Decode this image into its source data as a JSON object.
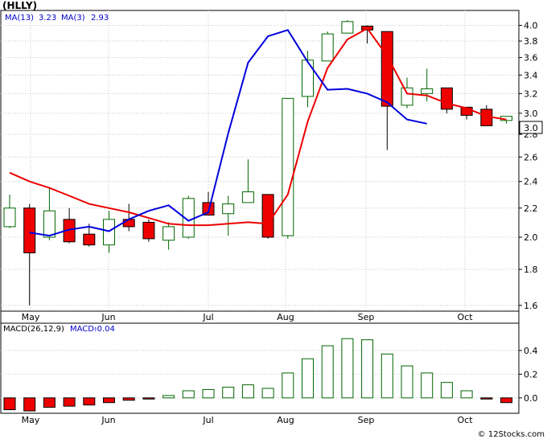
{
  "chart_data": [
    {
      "type": "candlestick",
      "title": "(HLLY)",
      "legend": [
        {
          "label": "MA(13)",
          "value": "3.23",
          "color": "#0000cc"
        },
        {
          "label": "MA(3)",
          "value": "2.93",
          "color": "#0000cc"
        }
      ],
      "price_axis": {
        "ticks": [
          "1.6",
          "1.8",
          "2.0",
          "2.2",
          "2.4",
          "2.6",
          "2.8",
          "3.0",
          "3.2",
          "3.4",
          "3.6",
          "3.8",
          "4.0"
        ],
        "log_scale": true,
        "range": [
          1.57,
          4.2
        ]
      },
      "last_price_label": "3.0",
      "months": [
        "May",
        "Jun",
        "Jul",
        "Aug",
        "Sep",
        "Oct"
      ],
      "candles": [
        {
          "o": 2.07,
          "h": 2.3,
          "l": 2.06,
          "c": 2.2
        },
        {
          "o": 2.2,
          "h": 2.23,
          "l": 1.6,
          "c": 1.9
        },
        {
          "o": 2.0,
          "h": 2.35,
          "l": 1.98,
          "c": 2.18
        },
        {
          "o": 2.12,
          "h": 2.2,
          "l": 1.96,
          "c": 1.97
        },
        {
          "o": 2.02,
          "h": 2.09,
          "l": 1.94,
          "c": 1.95
        },
        {
          "o": 1.95,
          "h": 2.18,
          "l": 1.9,
          "c": 2.12
        },
        {
          "o": 2.12,
          "h": 2.23,
          "l": 2.04,
          "c": 2.07
        },
        {
          "o": 2.1,
          "h": 2.12,
          "l": 1.97,
          "c": 1.99
        },
        {
          "o": 1.98,
          "h": 2.1,
          "l": 1.92,
          "c": 2.07
        },
        {
          "o": 2.0,
          "h": 2.29,
          "l": 1.99,
          "c": 2.27
        },
        {
          "o": 2.24,
          "h": 2.32,
          "l": 2.16,
          "c": 2.15
        },
        {
          "o": 2.16,
          "h": 2.29,
          "l": 2.01,
          "c": 2.23
        },
        {
          "o": 2.24,
          "h": 2.58,
          "l": 2.24,
          "c": 2.32
        },
        {
          "o": 2.3,
          "h": 2.3,
          "l": 1.99,
          "c": 2.0
        },
        {
          "o": 2.01,
          "h": 3.15,
          "l": 1.99,
          "c": 3.15
        },
        {
          "o": 3.17,
          "h": 3.68,
          "l": 3.06,
          "c": 3.57
        },
        {
          "o": 3.56,
          "h": 3.92,
          "l": 3.56,
          "c": 3.89
        },
        {
          "o": 3.9,
          "h": 4.07,
          "l": 3.9,
          "c": 4.05
        },
        {
          "o": 3.99,
          "h": 4.0,
          "l": 3.77,
          "c": 3.94
        },
        {
          "o": 3.92,
          "h": 3.92,
          "l": 2.66,
          "c": 3.07
        },
        {
          "o": 3.08,
          "h": 3.37,
          "l": 3.05,
          "c": 3.26
        },
        {
          "o": 3.2,
          "h": 3.47,
          "l": 3.12,
          "c": 3.25
        },
        {
          "o": 3.26,
          "h": 3.26,
          "l": 3.0,
          "c": 3.04
        },
        {
          "o": 3.06,
          "h": 3.06,
          "l": 2.94,
          "c": 2.98
        },
        {
          "o": 3.04,
          "h": 3.08,
          "l": 2.88,
          "c": 2.88
        },
        {
          "o": 2.93,
          "h": 2.97,
          "l": 2.9,
          "c": 2.97
        }
      ],
      "ma_red": [
        2.47,
        2.4,
        2.35,
        2.29,
        2.23,
        2.2,
        2.17,
        2.13,
        2.09,
        2.08,
        2.08,
        2.09,
        2.1,
        2.09,
        2.3,
        2.92,
        3.48,
        3.82,
        3.96,
        3.62,
        3.2,
        3.18,
        3.1,
        3.05,
        2.97,
        2.94
      ],
      "ma_red_start": 0,
      "ma_blue": [
        2.03,
        2.01,
        2.05,
        2.07,
        2.04,
        2.12,
        2.18,
        2.22,
        2.11,
        2.17,
        2.81,
        3.54,
        3.86,
        3.94,
        3.55,
        3.24,
        3.25,
        3.2,
        3.11,
        2.94,
        2.9
      ],
      "ma_blue_start": 1
    },
    {
      "type": "bar",
      "title": "MACD(26,12,9)",
      "legend": [
        {
          "label": "MACD:",
          "value": "-0.04",
          "color": "#0000cc"
        }
      ],
      "y_ticks": [
        "0.0",
        "0.2",
        "0.4"
      ],
      "ylim": [
        -0.13,
        0.63
      ],
      "values": [
        -0.1,
        -0.11,
        -0.08,
        -0.07,
        -0.06,
        -0.04,
        -0.02,
        -0.01,
        0.02,
        0.06,
        0.07,
        0.09,
        0.11,
        0.08,
        0.21,
        0.33,
        0.44,
        0.5,
        0.49,
        0.37,
        0.27,
        0.21,
        0.13,
        0.06,
        -0.01,
        -0.04
      ]
    }
  ],
  "watermark": "© 12Stocks.com"
}
